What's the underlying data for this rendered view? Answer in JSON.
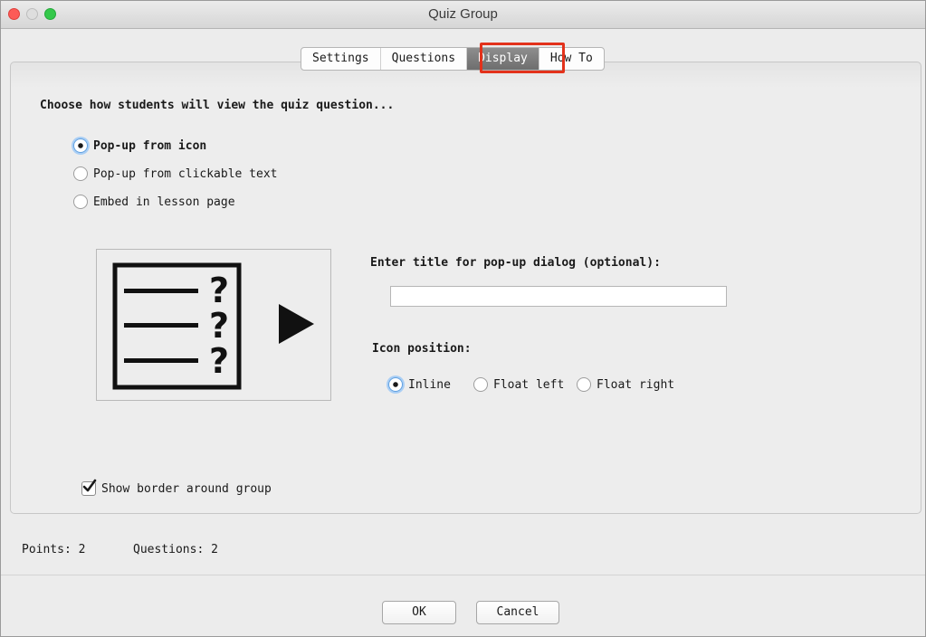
{
  "window": {
    "title": "Quiz Group"
  },
  "tabs": [
    {
      "label": "Settings",
      "active": false
    },
    {
      "label": "Questions",
      "active": false
    },
    {
      "label": "Display",
      "active": true
    },
    {
      "label": "How To",
      "active": false
    }
  ],
  "display": {
    "heading": "Choose how students will view the quiz question...",
    "view_options": [
      {
        "label": "Pop-up from icon",
        "selected": true
      },
      {
        "label": "Pop-up from clickable text",
        "selected": false
      },
      {
        "label": "Embed in lesson page",
        "selected": false
      }
    ],
    "preview_glyphs": {
      "question_mark": "?"
    },
    "title_label": "Enter title for pop-up dialog (optional):",
    "title_value": "",
    "icon_position_label": "Icon position:",
    "icon_positions": [
      {
        "label": "Inline",
        "selected": true
      },
      {
        "label": "Float left",
        "selected": false
      },
      {
        "label": "Float right",
        "selected": false
      }
    ],
    "show_border": {
      "label": "Show border around group",
      "checked": true
    }
  },
  "footer": {
    "points": "Points: 2",
    "questions": "Questions: 2"
  },
  "buttons": {
    "ok": "OK",
    "cancel": "Cancel"
  },
  "colors": {
    "highlight": "#e3321b",
    "active_tab": "#7a7a7a",
    "radio_focus": "#5e9fe0",
    "checkbox_check": "#1a1a1a"
  }
}
